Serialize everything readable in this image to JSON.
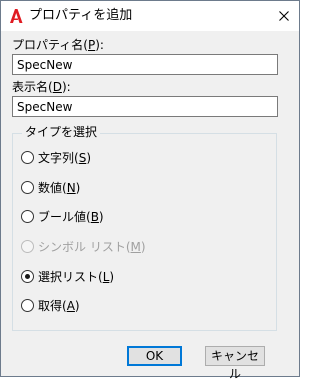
{
  "window": {
    "title": "プロパティを追加",
    "app_icon": "autocad-a-icon",
    "close_icon": "close-icon"
  },
  "property_name": {
    "label_text": "プロパティ名(",
    "label_mnemonic": "P",
    "label_suffix": "):",
    "value": "SpecNew"
  },
  "display_name": {
    "label_text": "表示名(",
    "label_mnemonic": "D",
    "label_suffix": "):",
    "value": "SpecNew"
  },
  "type_group": {
    "title": "タイプを選択",
    "options": [
      {
        "text": "文字列(",
        "mnemonic": "S",
        "suffix": ")",
        "selected": false,
        "enabled": true
      },
      {
        "text": "数値(",
        "mnemonic": "N",
        "suffix": ")",
        "selected": false,
        "enabled": true
      },
      {
        "text": "ブール値(",
        "mnemonic": "B",
        "suffix": ")",
        "selected": false,
        "enabled": true
      },
      {
        "text": "シンボル リスト(",
        "mnemonic": "M",
        "suffix": ")",
        "selected": false,
        "enabled": false
      },
      {
        "text": "選択リスト(",
        "mnemonic": "L",
        "suffix": ")",
        "selected": true,
        "enabled": true
      },
      {
        "text": "取得(",
        "mnemonic": "A",
        "suffix": ")",
        "selected": false,
        "enabled": true
      }
    ]
  },
  "buttons": {
    "ok": "OK",
    "cancel": "キャンセル"
  }
}
